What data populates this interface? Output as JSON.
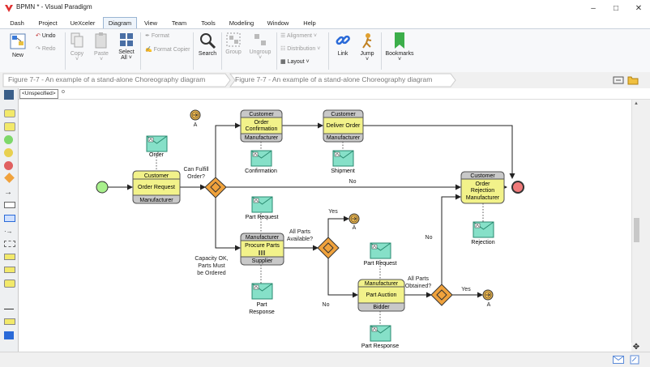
{
  "window": {
    "title": "BPMN * - Visual Paradigm"
  },
  "menu": [
    "Dash",
    "Project",
    "UeXceler",
    "Diagram",
    "View",
    "Team",
    "Tools",
    "Modeling",
    "Window",
    "Help"
  ],
  "ribbon": {
    "new": "New",
    "undo": "Undo",
    "redo": "Redo",
    "copy": "Copy",
    "paste": "Paste",
    "select_all_1": "Select",
    "select_all_2": "All",
    "format": "Format",
    "format_copier": "Format Copier",
    "search": "Search",
    "group": "Group",
    "ungroup": "Ungroup",
    "alignment": "Alignment",
    "distribution": "Distribution",
    "layout": "Layout",
    "link": "Link",
    "jump": "Jump",
    "bookmarks": "Bookmarks"
  },
  "breadcrumbs": [
    "Figure 7-7 - An example of a stand-alone Choreography diagram",
    "Figure 7-7 - An example of a stand-alone Choreography diagram"
  ],
  "property": {
    "unspecified": "<Unspecified>",
    "lock": "o"
  },
  "diagram": {
    "tasks": {
      "order_request": {
        "top": "Customer",
        "l1": "Order Request",
        "l2": "",
        "bottom": "Manufacturer"
      },
      "order_conf": {
        "top": "Customer",
        "l1": "Order",
        "l2": "Confirmation",
        "bottom": "Manufacturer"
      },
      "deliver": {
        "top": "Customer",
        "l1": "Deliver Order",
        "l2": "",
        "bottom": "Manufacturer"
      },
      "rejection": {
        "top": "Customer",
        "l1": "Order",
        "l2": "Rejection",
        "bottom": "Manufacturer"
      },
      "procure": {
        "top": "Manufacturer",
        "l1": "Procure Parts",
        "l2": "",
        "bottom": "Supplier"
      },
      "auction": {
        "top": "Manufacturer",
        "l1": "Part Auction",
        "l2": "",
        "bottom": "Bidder"
      }
    },
    "messages": {
      "order": "Order",
      "confirmation": "Confirmation",
      "shipment": "Shipment",
      "part_request_1": "Part Request",
      "part_response_1a": "Part",
      "part_response_1b": "Response",
      "rejection": "Rejection",
      "part_request_2": "Part Request",
      "part_response_2": "Part Response"
    },
    "labels": {
      "can_fulfill_1": "Can Fulfill",
      "can_fulfill_2": "Order?",
      "no": "No",
      "no2": "No",
      "no3": "No",
      "yes": "Yes",
      "yes2": "Yes",
      "all_parts_1": "All Parts",
      "all_parts_2": "Available?",
      "capacity_1": "Capacity OK,",
      "capacity_2": "Parts Must",
      "capacity_3": "be Ordered",
      "obtained_1": "All Parts",
      "obtained_2": "Obtained?",
      "link_a1": "A",
      "link_a2": "A",
      "link_a3": "A"
    }
  },
  "colors": {
    "task_yellow": "#f2f28a",
    "task_gray": "#c8c8c8",
    "message": "#86e0c8",
    "gateway": "#f0a23c",
    "start": "#a8f08c",
    "end": "#f07a7a",
    "link_event": "#f0b84c"
  }
}
